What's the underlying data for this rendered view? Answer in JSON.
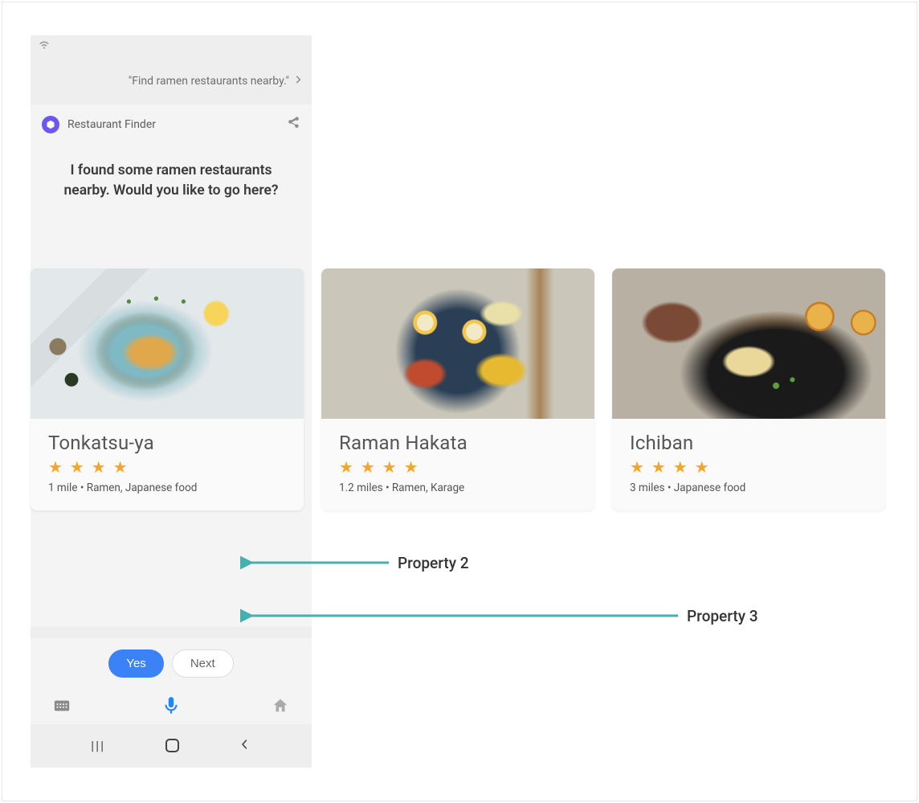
{
  "query": {
    "text": "\"Find ramen restaurants nearby.\""
  },
  "app": {
    "name": "Restaurant Finder"
  },
  "prompt": "I found some ramen restaurants nearby. Would you like to go here?",
  "restaurants": [
    {
      "name": "Tonkatsu-ya",
      "rating": 4,
      "meta": "1 mile • Ramen, Japanese food"
    },
    {
      "name": "Raman Hakata",
      "rating": 4,
      "meta": "1.2 miles • Ramen, Karage"
    },
    {
      "name": "Ichiban",
      "rating": 4,
      "meta": "3 miles • Japanese food"
    }
  ],
  "actions": {
    "yes": "Yes",
    "next": "Next"
  },
  "annotations": {
    "property2": "Property 2",
    "property3": "Property 3"
  },
  "colors": {
    "accent_blue": "#3b82f6",
    "star": "#f5a623",
    "arrow": "#3fa7a7",
    "app_icon_bg": "#6b58f0"
  }
}
